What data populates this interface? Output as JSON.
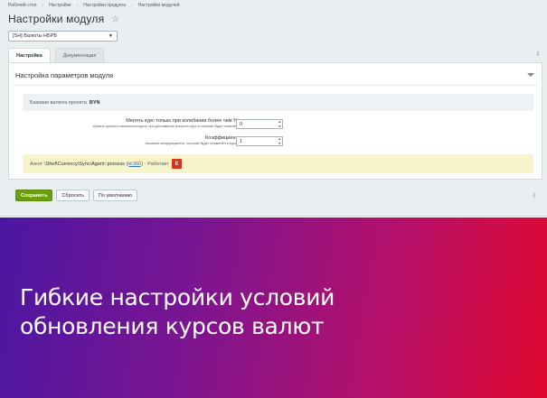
{
  "breadcrumb": [
    "Рабочий стол",
    "Настройки",
    "Настройки продукта",
    "Настройки модулей"
  ],
  "page": {
    "title": "Настройки модуля",
    "star_icon": "star-icon"
  },
  "module_select": {
    "value": "[SH] Валюты НБРБ"
  },
  "tabs": [
    {
      "label": "Настройка",
      "active": true
    },
    {
      "label": "Документация",
      "active": false
    }
  ],
  "panel": {
    "header": "Настройка параметров модуля",
    "base_currency_label": "Базовая валюта проекта",
    "base_currency_value": "BYN"
  },
  "fields": [
    {
      "label": "Менять курс только при колебании более чем %",
      "hint": "Указать процент изменения курса, при достижении которого курс в системе будет изменён",
      "value": "0"
    },
    {
      "label": "Коэффициент",
      "hint": "Указание коэффициента, который будет применён к курсу",
      "value": "1"
    }
  ],
  "agent": {
    "prefix": "Агент",
    "name": "\\Shef\\Currency\\Sync\\Agent::process",
    "link": "[id:360]",
    "status": "- Работает",
    "pause_label": "II"
  },
  "buttons": {
    "save": "Сохранить",
    "reset": "Сбросить",
    "defaults": "По умолчанию"
  },
  "banner": {
    "line1": "Гибкие настройки условий",
    "line2": "обновления курсов валют"
  },
  "colors": {
    "save_button": "#6c9f0e",
    "pause_button": "#d8311c",
    "agent_background": "#f8f4c9",
    "banner_start": "#4b16a2",
    "banner_end": "#e0082f"
  }
}
